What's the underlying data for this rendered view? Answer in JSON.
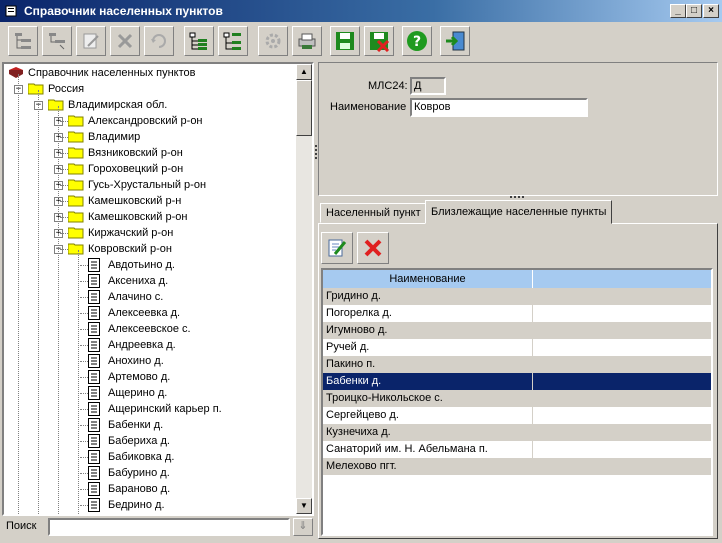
{
  "window": {
    "title": "Справочник населенных пунктов"
  },
  "window_buttons": {
    "minimize": "_",
    "maximize": "□",
    "close": "×"
  },
  "toolbar": [
    {
      "name": "tree-add-icon"
    },
    {
      "name": "tree-add-child-icon"
    },
    {
      "name": "edit-icon"
    },
    {
      "name": "delete-icon"
    },
    {
      "name": "refresh-icon"
    },
    {
      "name": "expand-tree-icon"
    },
    {
      "name": "collapse-tree-icon"
    },
    {
      "name": "settings-gear-icon"
    },
    {
      "name": "print-icon"
    },
    {
      "name": "save-icon"
    },
    {
      "name": "cancel-save-icon"
    },
    {
      "name": "help-icon"
    },
    {
      "name": "exit-icon"
    }
  ],
  "tree": {
    "root": "Справочник населенных пунктов",
    "country": "Россия",
    "region": "Владимирская обл.",
    "districts": [
      "Александровский р-он",
      "Владимир",
      "Вязниковский р-он",
      "Гороховецкий р-он",
      "Гусь-Хрустальный р-он",
      "Камешковский р-н",
      "Камешковский р-он",
      "Киржачский р-он",
      "Ковровский р-он"
    ],
    "settlements": [
      "Авдотьино д.",
      "Аксениха д.",
      "Алачино с.",
      "Алексеевка д.",
      "Алексеевское с.",
      "Андреевка д.",
      "Анохино д.",
      "Артемово д.",
      "Ащерино д.",
      "Ащеринский карьер п.",
      "Бабенки д.",
      "Бабериха д.",
      "Бабиковка д.",
      "Бабурино д.",
      "Бараново д.",
      "Бедрино д."
    ]
  },
  "search": {
    "label": "Поиск",
    "value": ""
  },
  "form": {
    "code_label": "МЛС24:",
    "code_value": "Д",
    "name_label": "Наименование",
    "name_value": "Ковров"
  },
  "tabs": [
    {
      "label": "Населенный пункт",
      "active": false
    },
    {
      "label": "Близлежащие населенные пункты",
      "active": true
    }
  ],
  "grid": {
    "columns": [
      "Наименование",
      ""
    ],
    "rows": [
      "Гридино д.",
      "Погорелка д.",
      "Игумново д.",
      "Ручей д.",
      "Пакино п.",
      "Бабенки д.",
      "Троицко-Никольское с.",
      "Сергейцево д.",
      "Кузнечиха д.",
      "Санаторий им. Н. Абельмана п.",
      "Мелехово пгт."
    ],
    "selected_index": 5
  }
}
